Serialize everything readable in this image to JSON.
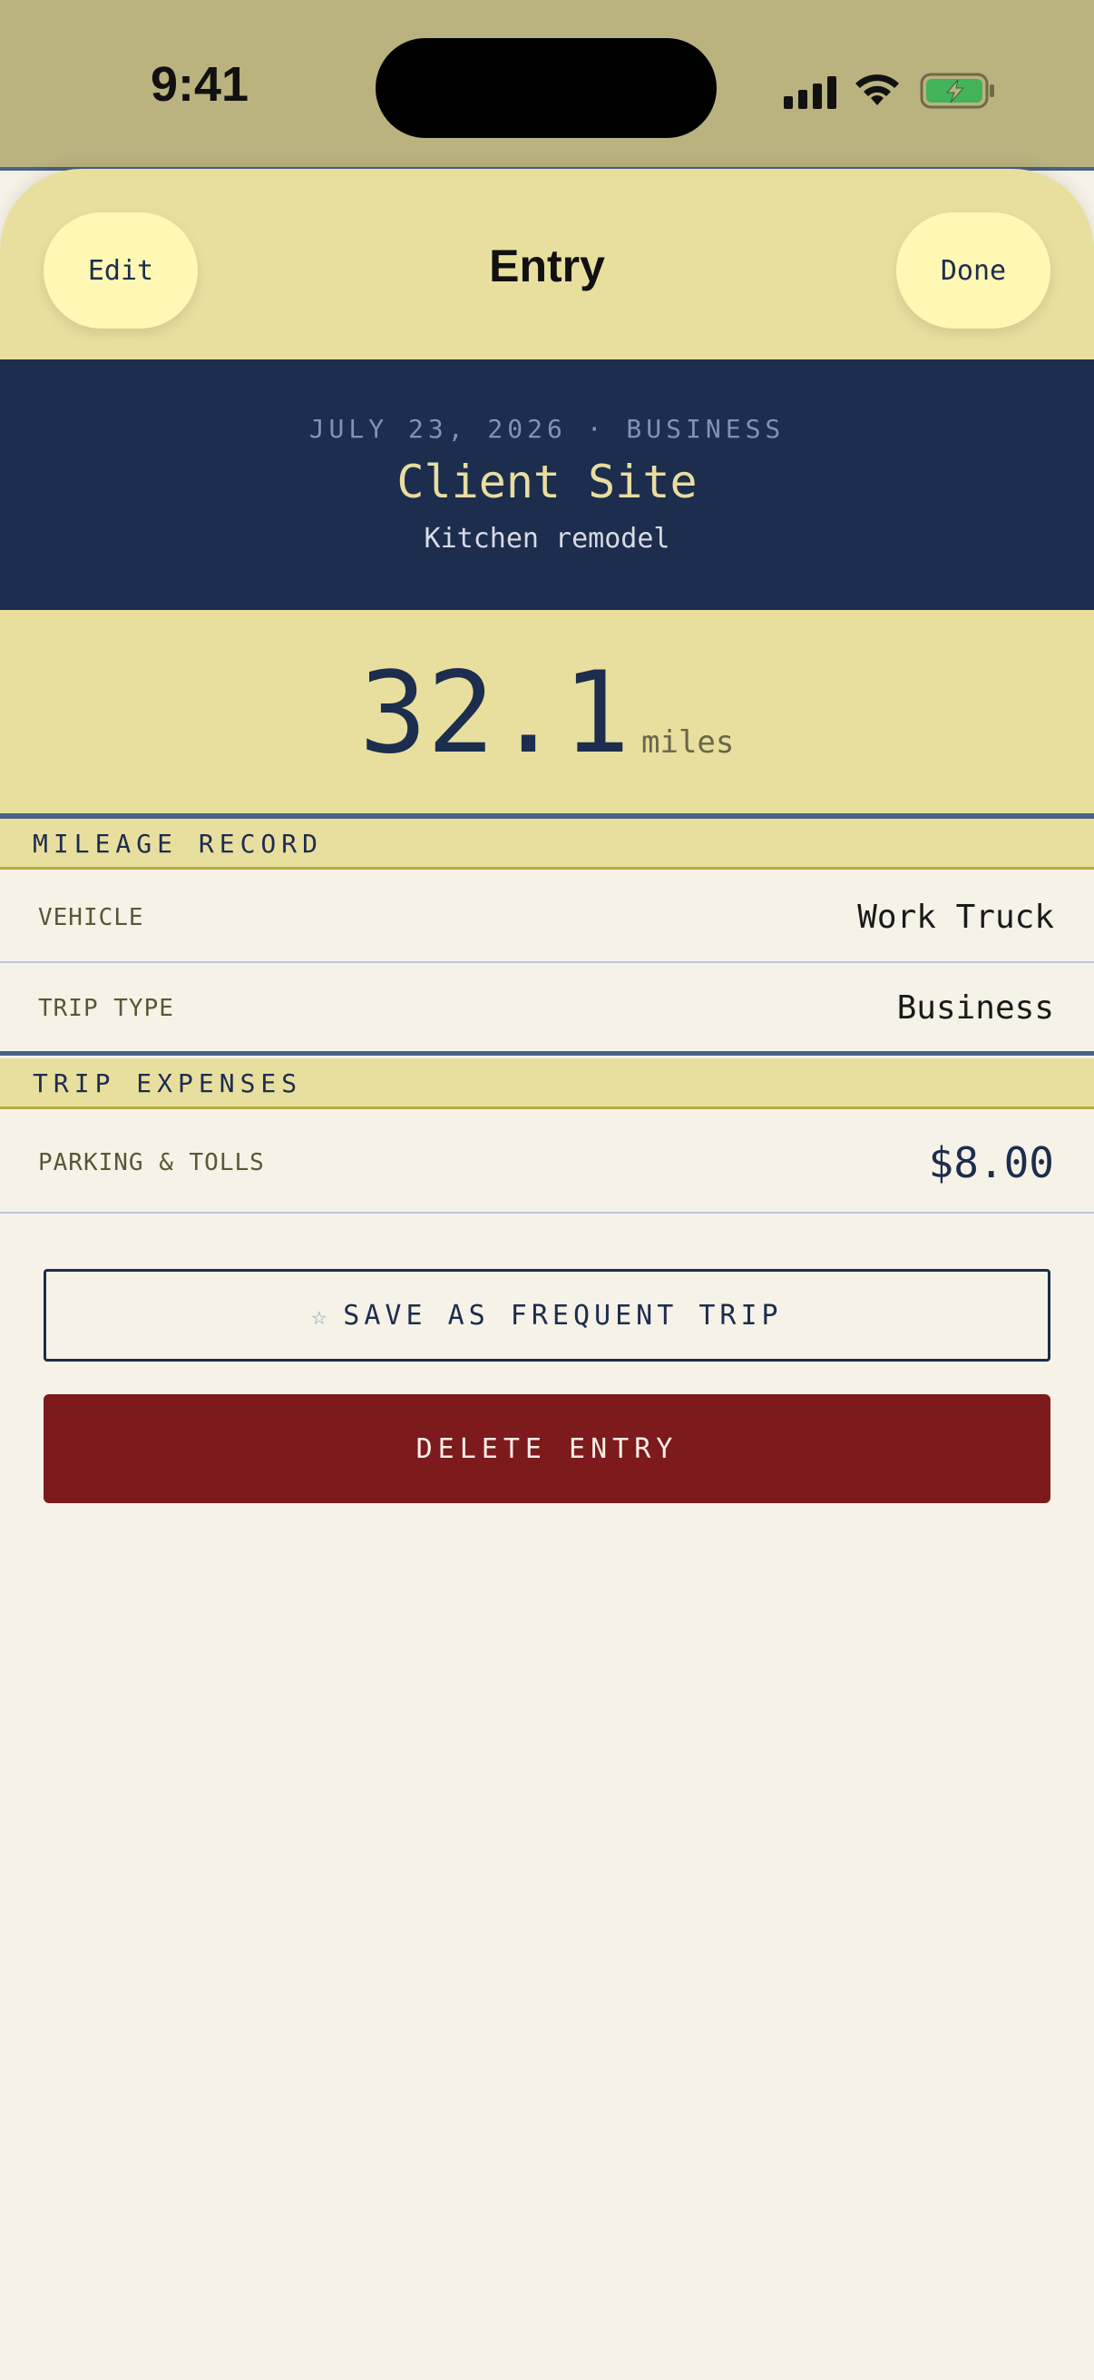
{
  "status_bar": {
    "time": "9:41",
    "icons": [
      "cellular-signal-icon",
      "wifi-icon",
      "battery-charging-icon"
    ],
    "battery_color": "#43b35a"
  },
  "nav": {
    "title": "Entry",
    "left_button": "Edit",
    "right_button": "Done"
  },
  "hero": {
    "date_line": "JULY 23, 2026 · BUSINESS",
    "title": "Client Site",
    "subtitle": "Kitchen remodel"
  },
  "summary": {
    "miles_value": "32.1",
    "miles_unit": "miles"
  },
  "sections": {
    "mileage": {
      "header": "MILEAGE RECORD",
      "rows": [
        {
          "label": "VEHICLE",
          "value": "Work Truck"
        },
        {
          "label": "TRIP TYPE",
          "value": "Business"
        }
      ]
    },
    "expenses": {
      "header": "TRIP EXPENSES",
      "rows": [
        {
          "label": "PARKING & TOLLS",
          "value": "$8.00"
        }
      ]
    }
  },
  "actions": {
    "save_frequent": "SAVE AS FREQUENT TRIP",
    "save_icon": "☆",
    "delete": "DELETE ENTRY"
  },
  "colors": {
    "navy": "#1c2d4e",
    "sand": "#e8df9f",
    "cream": "#f6f2e7",
    "danger": "#7c1a1c"
  }
}
